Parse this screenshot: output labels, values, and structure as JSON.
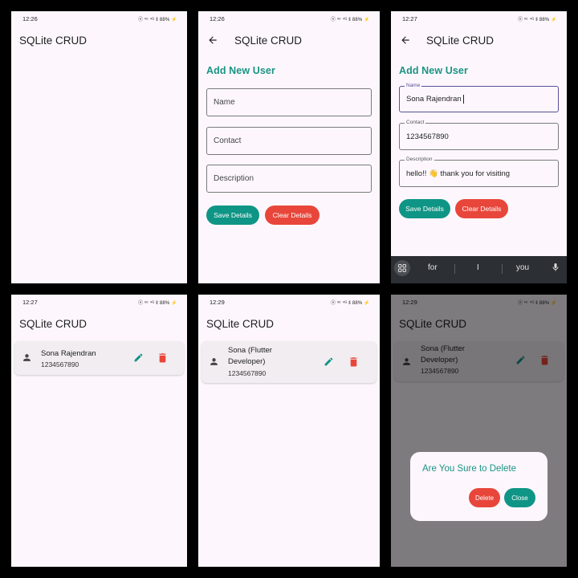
{
  "status_bar": [
    {
      "time": "12:26",
      "icons": "ⓝ ᵛᵒ ⁴ᴳ ‖ 88% ⚡"
    },
    {
      "time": "12:26",
      "icons": "ⓝ ᵛᵒ ⁴ᴳ ‖ 88% ⚡"
    },
    {
      "time": "12:27",
      "icons": "ⓝ ᵛᵒ ⁴ᴳ ‖ 88% ⚡"
    },
    {
      "time": "12:27",
      "icons": "ⓝ ᵛᵒ ⁴ᴳ ‖ 88% ⚡"
    },
    {
      "time": "12:29",
      "icons": "ⓝ ᵛᵒ ⁴ᴳ ‖ 88% ⚡"
    },
    {
      "time": "12:29",
      "icons": "ⓝ ᵛᵒ ⁴ᴳ ‖ 88% ⚡"
    }
  ],
  "app_title": "SQLite CRUD",
  "form": {
    "title": "Add New User",
    "name_label": "Name",
    "contact_label": "Contact",
    "description_label": "Description",
    "save_label": "Save Details",
    "clear_label": "Clear Details"
  },
  "filled": {
    "name": "Sona Rajendran",
    "contact": "1234567890",
    "description": "hello!! 👋 thank you for visiting"
  },
  "keyboard": {
    "suggestions": [
      "for",
      "I",
      "you"
    ]
  },
  "users_before": [
    {
      "name": "Sona Rajendran",
      "contact": "1234567890"
    }
  ],
  "users_after": [
    {
      "name_line1": "Sona (Flutter",
      "name_line2": "Developer)",
      "contact": "1234567890"
    }
  ],
  "dialog": {
    "title": "Are You Sure to Delete",
    "delete_label": "Delete",
    "close_label": "Close"
  },
  "colors": {
    "accent": "#0f9585",
    "danger": "#e8463a",
    "background": "#fdf7fd"
  },
  "icons": {
    "back": "arrow-back-icon",
    "person": "person-icon",
    "edit": "edit-pencil-icon",
    "delete": "trash-icon",
    "grid": "apps-grid-icon",
    "mic": "mic-icon"
  }
}
